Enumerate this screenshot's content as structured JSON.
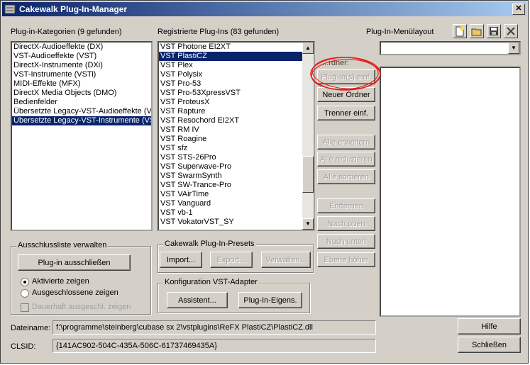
{
  "window": {
    "title": "Cakewalk Plug-In-Manager",
    "close_glyph": "✕"
  },
  "categories": {
    "label": "Plug-in-Kategorien (9 gefunden)",
    "items": [
      "DirectX-Audioeffekte (DX)",
      "VST-Audioeffekte (VST)",
      "DirectX-Instrumente (DXi)",
      "VST-Instrumente (VSTi)",
      "MIDI-Effekte (MFX)",
      "DirectX Media Objects (DMO)",
      "Bedienfelder",
      "Übersetzte Legacy-VST-Audioeffekte (VST)",
      "Übersetzte Legacy-VST-Instrumente (VSTi)"
    ],
    "selected_index": 8
  },
  "plugins": {
    "label": "Registrierte Plug-Ins (83 gefunden)",
    "items": [
      "VST Photone EI2XT",
      "VST PlastiCZ",
      "VST Plex",
      "VST Polysix",
      "VST Pro-53",
      "VST Pro-53XpressVST",
      "VST ProteusX",
      "VST Rapture",
      "VST Resochord EI2XT",
      "VST RM IV",
      "VST Roagine",
      "VST sfz",
      "VST STS-26Pro",
      "VST Superwave-Pro",
      "VST SwarmSynth",
      "VST SW-Trance-Pro",
      "VST VAirTime",
      "VST Vanguard",
      "VST vb-1",
      "VST VokatorVST_SY"
    ],
    "selected_index": 1,
    "scroll_position": 0.8
  },
  "menu_layout": {
    "label": "Plug-In-Menülayout",
    "combo_value": "",
    "partial_label": "...rdner:"
  },
  "middle_buttons": {
    "insert_plugins": "Plug-In(s) einf.",
    "new_folder": "Neuer Ordner",
    "insert_separator": "Trenner einf.",
    "expand_all": "Alle erweitern",
    "collapse_all": "Alle reduzieren",
    "sort_all": "Alle sortieren",
    "remove": "Entfernen",
    "move_up": "Nach oben",
    "move_down": "Nach unten",
    "level_up": "Ebene höher"
  },
  "exclusion": {
    "group_title": "Ausschlussliste verwalten",
    "exclude_button": "Plug-in ausschließen",
    "show_active": "Aktivierte zeigen",
    "show_excluded": "Ausgeschlossene zeigen",
    "permanent": "Dauerhaft ausgeschl. zeigen",
    "selected": "show_active"
  },
  "presets": {
    "group_title": "Cakewalk Plug-In-Presets",
    "import": "Import...",
    "export": "Export...",
    "manage": "Verwalten..."
  },
  "vst_adapter": {
    "group_title": "Konfiguration VST-Adapter",
    "wizard": "Assistent...",
    "properties": "Plug-In-Eigens."
  },
  "info": {
    "filename_label": "Dateiname:",
    "filename_value": "f:\\programme\\steinberg\\cubase sx 2\\vstplugins\\ReFX PlastiCZ\\PlastiCZ.dll",
    "clsid_label": "CLSID:",
    "clsid_value": "{141AC902-504C-435A-506C-61737469435A}"
  },
  "dialog_buttons": {
    "help": "Hilfe",
    "close": "Schließen"
  },
  "colors": {
    "selection": "#0a246a",
    "annotation": "#e0201c",
    "face": "#d4d0c8"
  }
}
